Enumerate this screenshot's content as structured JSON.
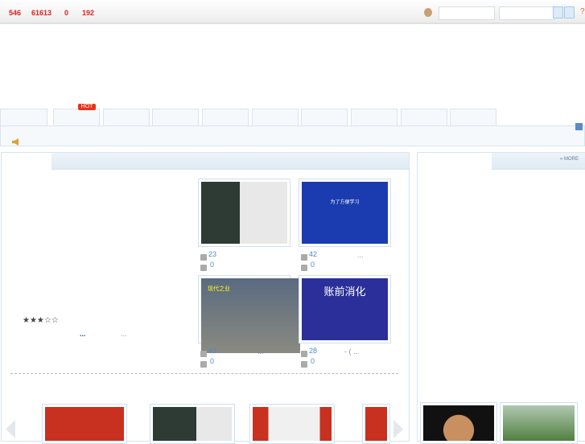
{
  "topbar": {
    "stats": [
      "546",
      "61613",
      "0",
      "192"
    ],
    "help": "?"
  },
  "nav": {
    "hot_badge": "HOT",
    "tab_count": 10
  },
  "main": {
    "videos": [
      {
        "plays": "23",
        "comments": "0",
        "extra": ""
      },
      {
        "plays": "42",
        "comments": "0",
        "extra": "...",
        "thumb_text": "为了方便学习"
      },
      {
        "plays": "42",
        "comments": "0",
        "extra": "...",
        "thumb_text": "现代之业"
      },
      {
        "plays": "28",
        "comments": "0",
        "extra": "- ( ...",
        "thumb_text": "账前消化"
      }
    ],
    "rating": "★★★☆☆",
    "rating_value": 3,
    "links": [
      "...",
      "..."
    ]
  },
  "side": {
    "more": "» MORE"
  },
  "colors": {
    "accent": "#e0201a",
    "link": "#4a8ad0",
    "border": "#d8e4ee"
  }
}
